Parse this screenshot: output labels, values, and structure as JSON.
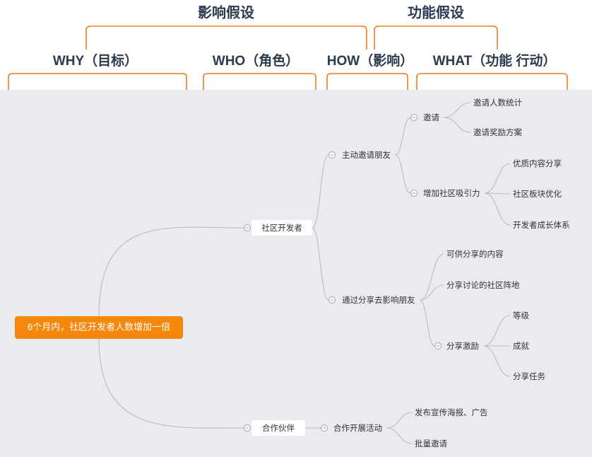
{
  "headers": {
    "top": [
      {
        "id": "impact-assumption",
        "label": "影响假设"
      },
      {
        "id": "feature-assumption",
        "label": "功能假设"
      }
    ],
    "columns": [
      {
        "id": "why",
        "label": "WHY（目标）"
      },
      {
        "id": "who",
        "label": "WHO（角色）"
      },
      {
        "id": "how",
        "label": "HOW（影响）"
      },
      {
        "id": "what",
        "label": "WHAT（功能 行动）"
      }
    ]
  },
  "colors": {
    "accent": "#ee7b22",
    "root_fill": "#f5870c",
    "canvas_bg": "#e9ebee",
    "header_text": "#2b3a4f",
    "link": "#b8bcc2"
  },
  "mindmap": {
    "root": "6个月内，社区开发者人数增加一倍",
    "roles": [
      {
        "label": "社区开发者",
        "impacts": [
          {
            "label": "主动邀请朋友",
            "actions": [
              {
                "label": "邀请",
                "children": [
                  "邀请人数统计",
                  "邀请奖励方案"
                ]
              },
              {
                "label": "增加社区吸引力",
                "children": [
                  "优质内容分享",
                  "社区板块优化",
                  "开发者成长体系"
                ]
              }
            ]
          },
          {
            "label": "通过分享去影响朋友",
            "actions": [
              {
                "label": "可供分享的内容",
                "children": []
              },
              {
                "label": "分享讨论的社区阵地",
                "children": []
              },
              {
                "label": "分享激励",
                "children": [
                  "等级",
                  "成就",
                  "分享任务"
                ]
              }
            ]
          }
        ]
      },
      {
        "label": "合作伙伴",
        "impacts": [
          {
            "label": "合作开展活动",
            "actions": [
              {
                "label": "发布宣传海报、广告",
                "children": []
              },
              {
                "label": "批量邀请",
                "children": []
              }
            ]
          }
        ]
      }
    ]
  }
}
